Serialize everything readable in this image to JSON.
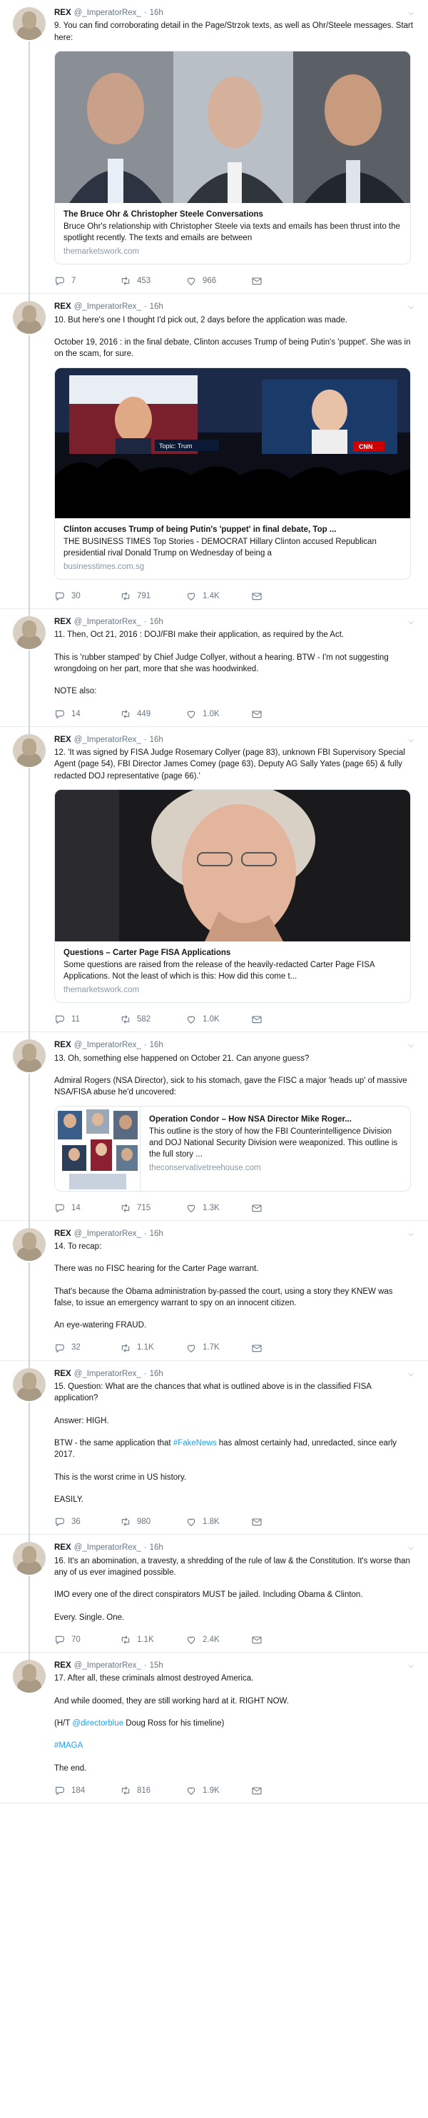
{
  "author": {
    "name": "REX",
    "handle": "@_ImperatorRex_"
  },
  "tweets": [
    {
      "time": "16h",
      "paragraphs": [
        [
          {
            "t": "9. You can find corroborating detail in the Page/Strzok texts, as well as Ohr/Steele messages. Start here:"
          }
        ]
      ],
      "card": {
        "kind": "large",
        "img": "three-men",
        "title": "The Bruce Ohr & Christopher Steele Conversations",
        "desc": "Bruce Ohr's relationship with Christopher Steele via texts and emails has been thrust into the spotlight recently. The texts and emails are between",
        "domain": "themarketswork.com"
      },
      "replies": "7",
      "retweets": "453",
      "likes": "966"
    },
    {
      "time": "16h",
      "paragraphs": [
        [
          {
            "t": "10. But here's one I thought I'd pick out, 2 days before the application was made."
          }
        ],
        [
          {
            "t": "October 19, 2016 : in the final debate, Clinton accuses Trump of being Putin's 'puppet'. She was in on the scam, for sure."
          }
        ]
      ],
      "card": {
        "kind": "large",
        "img": "debate",
        "img_label_1": "Topic: Trum",
        "img_label_2": "CNN",
        "title": "Clinton accuses Trump of being Putin's 'puppet' in final debate, Top ...",
        "desc": "THE BUSINESS TIMES Top Stories - DEMOCRAT Hillary Clinton accused Republican presidential rival Donald Trump on Wednesday of being a",
        "domain": "businesstimes.com.sg"
      },
      "replies": "30",
      "retweets": "791",
      "likes": "1.4K"
    },
    {
      "time": "16h",
      "paragraphs": [
        [
          {
            "t": "11. Then, Oct 21, 2016 : DOJ/FBI make their application, as required by the Act."
          }
        ],
        [
          {
            "t": "This is 'rubber stamped' by Chief Judge Collyer, without a hearing. BTW - I'm not suggesting wrongdoing on her part, more that she was hoodwinked."
          }
        ],
        [
          {
            "t": "NOTE also:"
          }
        ]
      ],
      "card": null,
      "replies": "14",
      "retweets": "449",
      "likes": "1.0K"
    },
    {
      "time": "16h",
      "paragraphs": [
        [
          {
            "t": "12. 'It was signed by FISA Judge Rosemary Collyer (page 83), unknown FBI Supervisory Special Agent (page 54), FBI Director James Comey (page 63), Deputy AG Sally Yates (page 65) & fully redacted DOJ representative (page 66).'"
          }
        ]
      ],
      "card": {
        "kind": "large",
        "img": "woman",
        "title": "Questions – Carter Page FISA Applications",
        "desc": "Some questions are raised from the release of the heavily-redacted Carter Page FISA Applications. Not the least of which is this: How did this come t...",
        "domain": "themarketswork.com"
      },
      "replies": "11",
      "retweets": "582",
      "likes": "1.0K"
    },
    {
      "time": "16h",
      "paragraphs": [
        [
          {
            "t": "13. Oh, something else happened on October 21. Can anyone guess?"
          }
        ],
        [
          {
            "t": "Admiral Rogers (NSA Director), sick to his stomach, gave the FISC a major 'heads up' of massive NSA/FISA abuse he'd uncovered:"
          }
        ]
      ],
      "card": {
        "kind": "small",
        "img": "collage",
        "title": "Operation Condor – How NSA Director Mike Roger...",
        "desc": "This outline is the story of how the FBI Counterintelligence Division and DOJ National Security Division were weaponized. This outline is the full story ...",
        "domain": "theconservativetreehouse.com"
      },
      "replies": "14",
      "retweets": "715",
      "likes": "1.3K"
    },
    {
      "time": "16h",
      "paragraphs": [
        [
          {
            "t": "14. To recap:"
          }
        ],
        [
          {
            "t": "There was no FISC hearing for the Carter Page warrant."
          }
        ],
        [
          {
            "t": "That's because the Obama administration by-passed the court, using a story they KNEW was false, to issue an emergency warrant to spy on an innocent citizen."
          }
        ],
        [
          {
            "t": "An eye-watering FRAUD."
          }
        ]
      ],
      "card": null,
      "replies": "32",
      "retweets": "1.1K",
      "likes": "1.7K"
    },
    {
      "time": "16h",
      "paragraphs": [
        [
          {
            "t": "15. Question: What are the chances that what is outlined above is in the classified FISA application?"
          }
        ],
        [
          {
            "t": "Answer: HIGH."
          }
        ],
        [
          {
            "t": "BTW - the same application that "
          },
          {
            "t": "#FakeNews",
            "link": true
          },
          {
            "t": " has almost certainly had, unredacted, since early 2017."
          }
        ],
        [
          {
            "t": "This is the worst crime in US history."
          }
        ],
        [
          {
            "t": "EASILY."
          }
        ]
      ],
      "card": null,
      "replies": "36",
      "retweets": "980",
      "likes": "1.8K"
    },
    {
      "time": "16h",
      "paragraphs": [
        [
          {
            "t": "16. It's an abomination, a travesty, a shredding of the rule of law & the Constitution. It's worse than any of us ever imagined possible."
          }
        ],
        [
          {
            "t": "IMO every one of the direct conspirators MUST be jailed. Including Obama & Clinton."
          }
        ],
        [
          {
            "t": "Every. Single. One."
          }
        ]
      ],
      "card": null,
      "replies": "70",
      "retweets": "1.1K",
      "likes": "2.4K"
    },
    {
      "time": "15h",
      "paragraphs": [
        [
          {
            "t": "17. After all, these criminals almost destroyed America."
          }
        ],
        [
          {
            "t": "And while doomed, they are still working hard at it. RIGHT NOW."
          }
        ],
        [
          {
            "t": "(H/T "
          },
          {
            "t": "@directorblue",
            "link": true
          },
          {
            "t": " Doug Ross for his timeline)"
          }
        ],
        [
          {
            "t": "#MAGA",
            "link": true
          }
        ],
        [
          {
            "t": "The end."
          }
        ]
      ],
      "card": null,
      "replies": "184",
      "retweets": "816",
      "likes": "1.9K"
    }
  ],
  "colors": {
    "link": "#1da1f2",
    "muted": "#657786",
    "border": "#e1e8ed"
  },
  "icons": [
    "reply-icon",
    "retweet-icon",
    "like-icon",
    "dm-icon",
    "chevron-down-icon"
  ]
}
